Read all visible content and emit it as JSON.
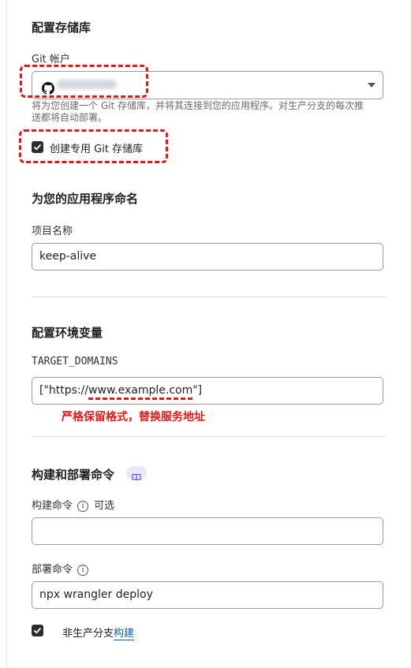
{
  "repo_section": {
    "title": "配置存储库",
    "git_account_label": "Git 帐户",
    "help_text_line1": "将为您创建一个 Git 存储库，并将其连接到您的应用程序。对生产分支的每次推",
    "help_text_line2": "送都将自动部署。",
    "create_repo_label": "创建专用 Git 存储库",
    "create_repo_checked": true
  },
  "name_section": {
    "title": "为您的应用程序命名",
    "project_name_label": "项目名称",
    "project_name_value": "keep-alive"
  },
  "env_section": {
    "title": "配置环境变量",
    "var_name": "TARGET_DOMAINS",
    "var_value_prefix": "[\"https://",
    "var_value_host": "www.example.com",
    "var_value_suffix": "\"]",
    "annotation": "严格保留格式，替换服务地址"
  },
  "build_section": {
    "title": "构建和部署命令",
    "build_cmd_label": "构建命令",
    "build_cmd_optional": "可选",
    "build_cmd_value": "",
    "deploy_cmd_label": "部署命令",
    "deploy_cmd_value": "npx wrangler deploy",
    "nonprod_label_prefix": "非生产分支",
    "nonprod_label_link": "构建",
    "nonprod_checked": true
  },
  "icons": {
    "github": "github-icon",
    "dropdown": "chevron-down-icon",
    "info": "info-icon",
    "docs": "book-icon"
  },
  "colors": {
    "annotation_red": "#e01818",
    "link_blue": "#0b5cad",
    "badge_bg": "#ece8fb"
  }
}
